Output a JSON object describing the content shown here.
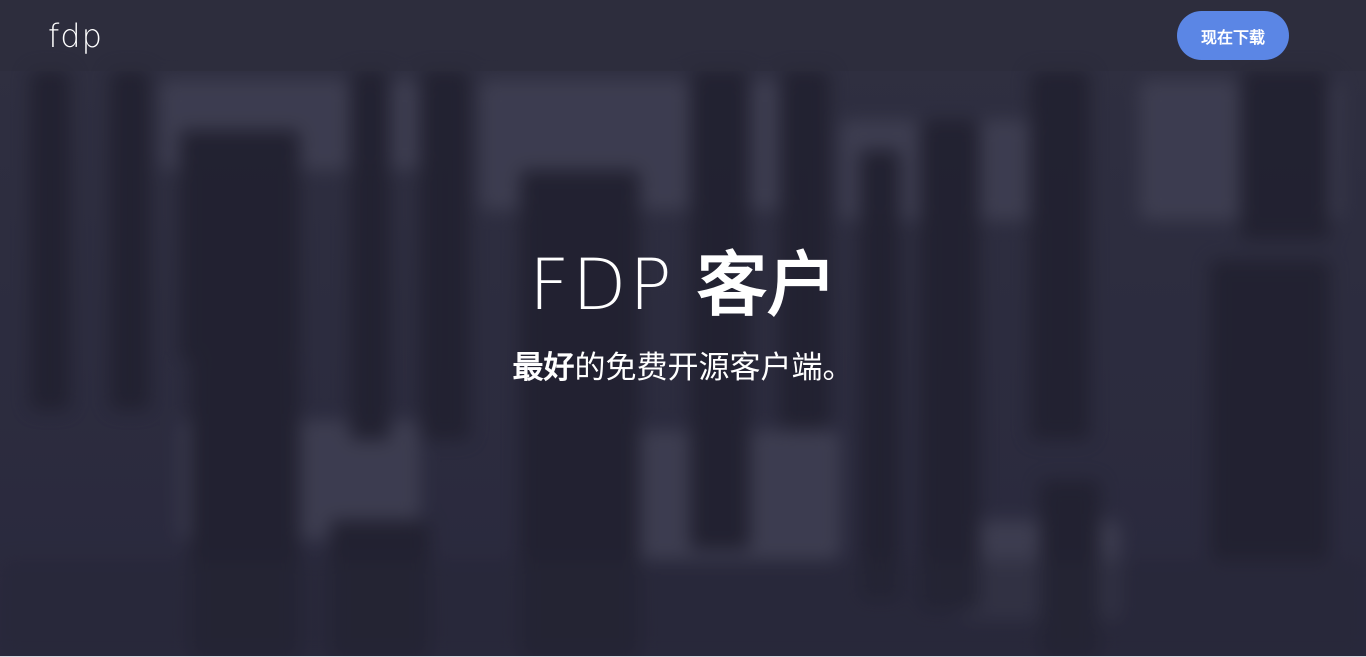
{
  "header": {
    "logo_text": "fdp",
    "download_label": "现在下载"
  },
  "hero": {
    "title_latin": "FDP",
    "title_cjk": "客户",
    "subtitle_bold": "最好",
    "subtitle_rest": "的免费开源客户端。"
  },
  "colors": {
    "accent": "#5b86e5",
    "background": "#2f2f42",
    "text": "#ffffff"
  }
}
